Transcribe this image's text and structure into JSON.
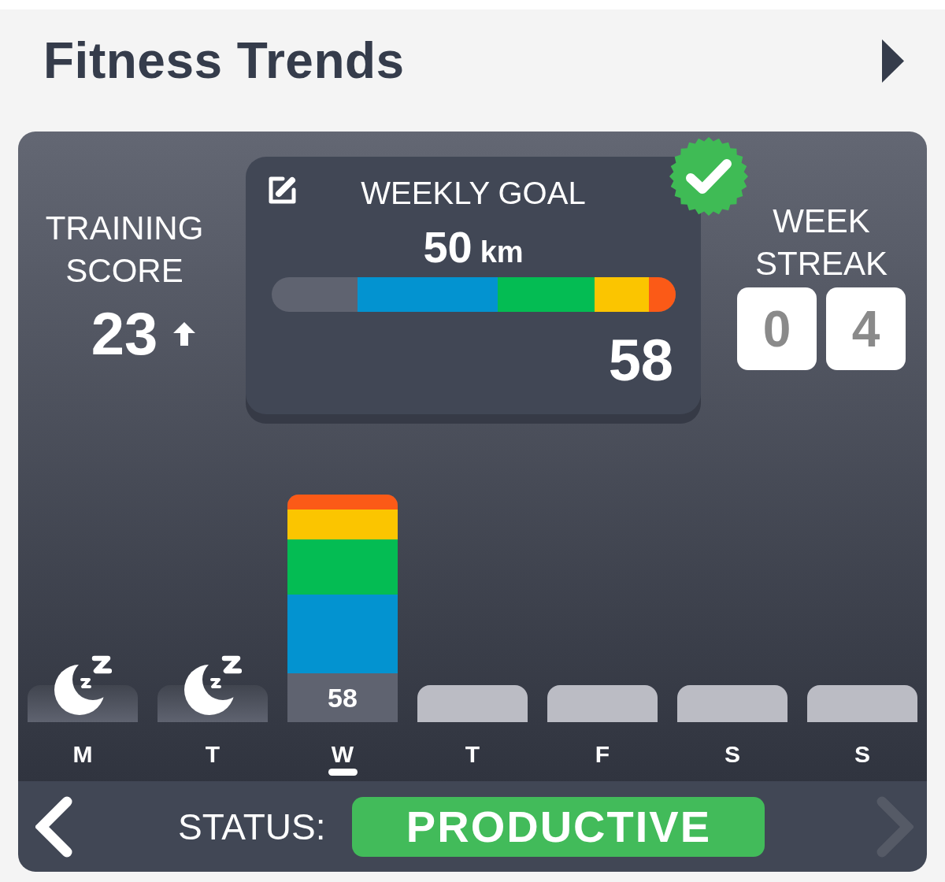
{
  "header": {
    "title": "Fitness Trends"
  },
  "training_score": {
    "label": "TRAINING SCORE",
    "value": "23",
    "rising": true
  },
  "weekly_goal": {
    "title": "WEEKLY GOAL",
    "target_value": "50",
    "target_unit": "km",
    "total": "58",
    "completed": true
  },
  "week_streak": {
    "label": "WEEK STREAK",
    "digits": [
      "0",
      "4"
    ]
  },
  "days": [
    {
      "label": "M",
      "kind": "rest",
      "selected": false
    },
    {
      "label": "T",
      "kind": "rest",
      "selected": false
    },
    {
      "label": "W",
      "kind": "ride",
      "selected": true,
      "value": "58"
    },
    {
      "label": "T",
      "kind": "future",
      "selected": false
    },
    {
      "label": "F",
      "kind": "future",
      "selected": false
    },
    {
      "label": "S",
      "kind": "future",
      "selected": false
    },
    {
      "label": "S",
      "kind": "future",
      "selected": false
    }
  ],
  "status_bar": {
    "label": "STATUS:",
    "value": "PRODUCTIVE",
    "previous_disabled": false,
    "next_disabled": true
  }
}
